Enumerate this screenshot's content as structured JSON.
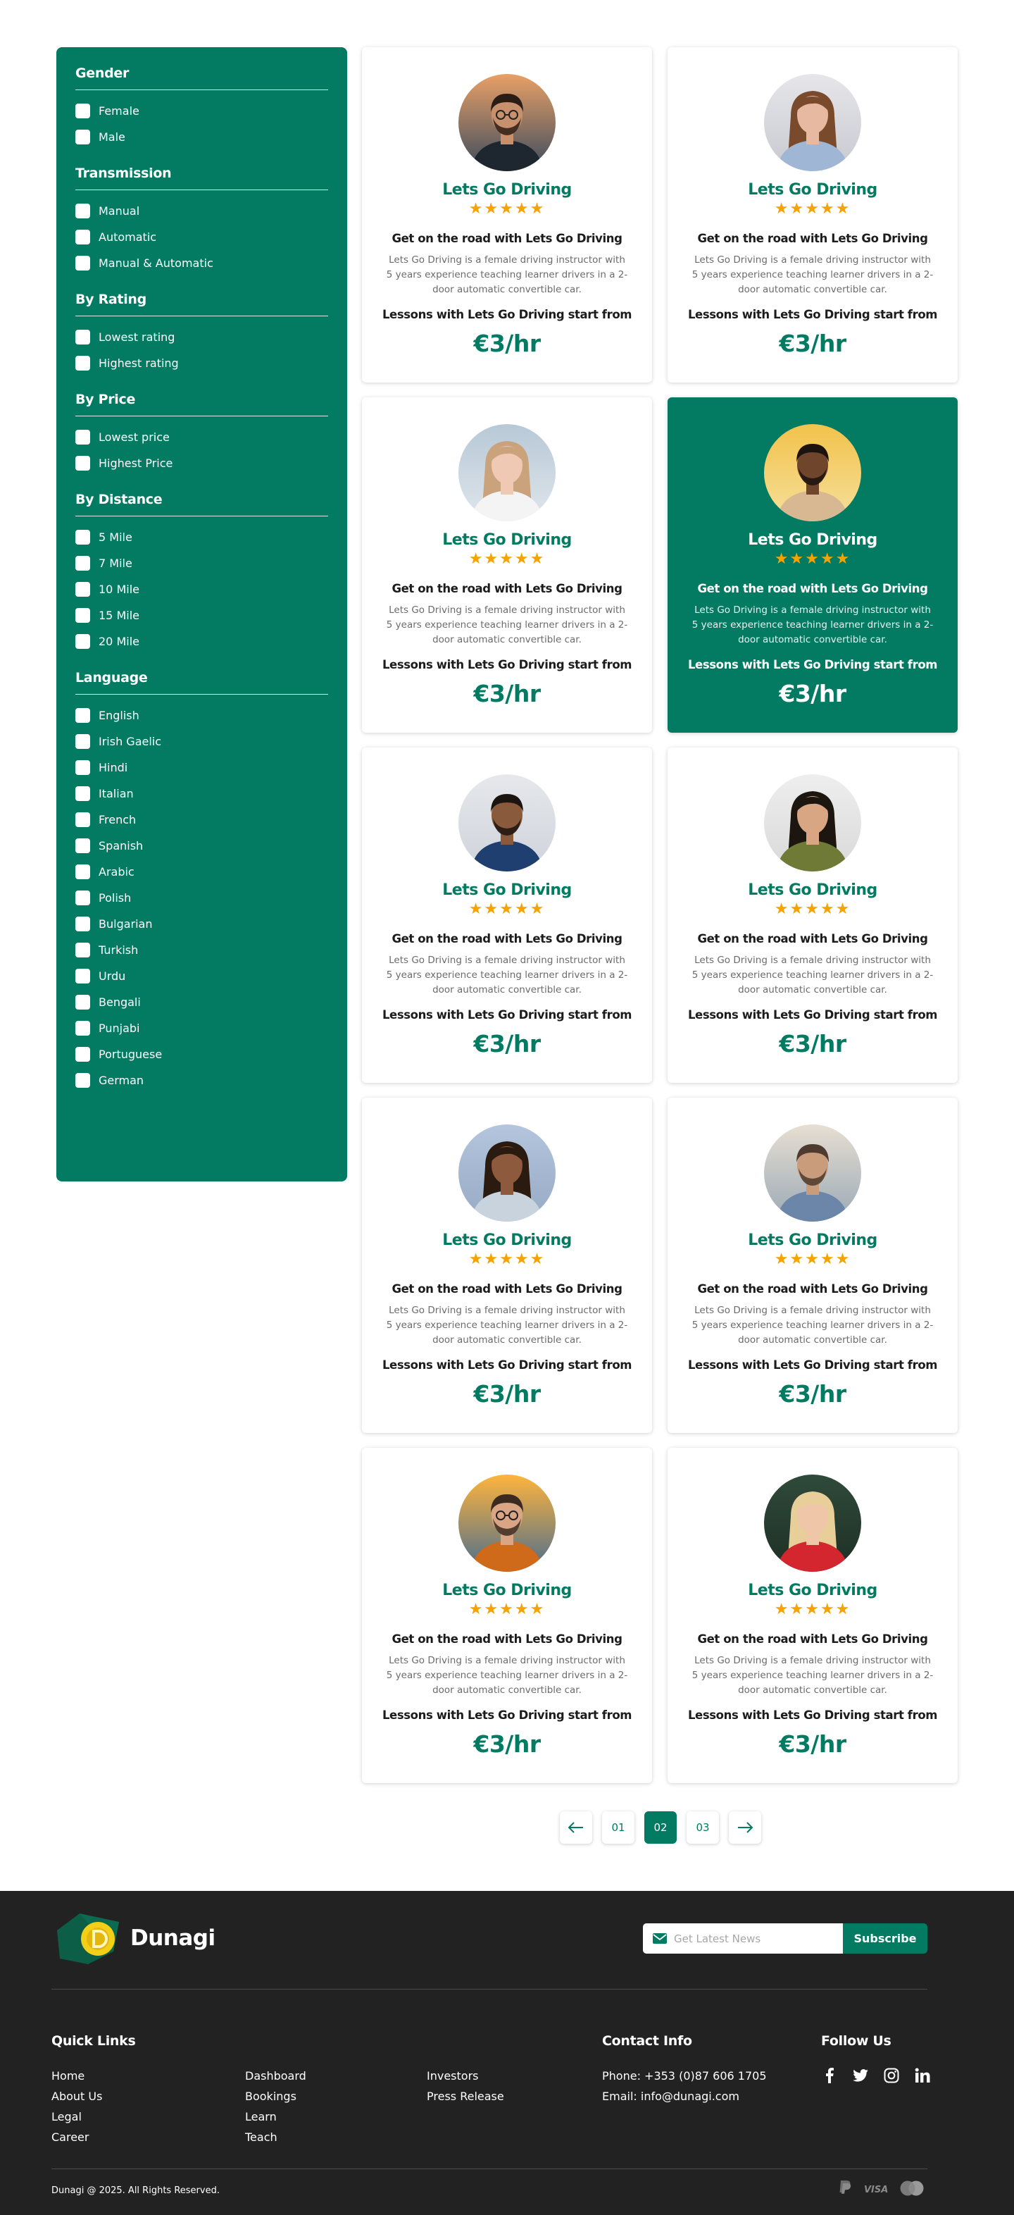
{
  "filters": [
    {
      "title": "Gender",
      "options": [
        "Female",
        "Male"
      ]
    },
    {
      "title": "Transmission",
      "options": [
        "Manual",
        "Automatic",
        "Manual & Automatic"
      ]
    },
    {
      "title": "By Rating",
      "options": [
        "Lowest rating",
        "Highest rating"
      ]
    },
    {
      "title": "By Price",
      "options": [
        "Lowest price",
        "Highest Price"
      ]
    },
    {
      "title": "By Distance",
      "options": [
        "5 Mile",
        "7 Mile",
        "10 Mile",
        "15 Mile",
        "20 Mile"
      ]
    },
    {
      "title": "Language",
      "options": [
        "English",
        "Irish Gaelic",
        "Hindi",
        "Italian",
        "French",
        "Spanish",
        "Arabic",
        "Polish",
        "Bulgarian",
        "Turkish",
        "Urdu",
        "Bengali",
        "Punjabi",
        "Portuguese",
        "German"
      ]
    }
  ],
  "card_text": {
    "name": "Lets Go Driving",
    "stars": "★★★★★",
    "tagline": "Get on the road with Lets Go Driving",
    "description": "Lets Go Driving is a female driving instructor with 5 years experience teaching learner drivers in a 2-door automatic convertible car.",
    "lesson": "Lessons with Lets Go Driving start from",
    "price": "€3/hr"
  },
  "cards": [
    {
      "photo": "man-sunset-glasses",
      "active": false
    },
    {
      "photo": "woman-long-hair",
      "active": false
    },
    {
      "photo": "woman-thinking",
      "active": false
    },
    {
      "photo": "man-phone-smiling",
      "active": true
    },
    {
      "photo": "man-blue-sweater",
      "active": false
    },
    {
      "photo": "woman-green-shirt",
      "active": false
    },
    {
      "photo": "woman-curly-hair",
      "active": false
    },
    {
      "photo": "man-denim-jacket",
      "active": false
    },
    {
      "photo": "man-orange-jacket",
      "active": false
    },
    {
      "photo": "woman-red-top",
      "active": false
    }
  ],
  "pagination": {
    "prev": "←",
    "pages": [
      "01",
      "02",
      "03"
    ],
    "current": "02",
    "next": "→"
  },
  "footer": {
    "brand": "Dunagi",
    "newsletter_placeholder": "Get Latest News",
    "subscribe": "Subscribe",
    "quick_links_title": "Quick Links",
    "links_col1": [
      "Home",
      "About Us",
      "Legal",
      "Career"
    ],
    "links_col2": [
      "Dashboard",
      "Bookings",
      "Learn",
      "Teach"
    ],
    "links_col3": [
      "Investors",
      "Press Release"
    ],
    "contact_title": "Contact Info",
    "phone": "Phone: +353 (0)87 606 1705",
    "email": "Email: info@dunagi.com",
    "follow_title": "Follow Us",
    "social": [
      "facebook-icon",
      "twitter-icon",
      "instagram-icon",
      "linkedin-icon"
    ],
    "copyright": "Dunagi @ 2025. All Rights Reserved.",
    "payments": [
      "paypal-icon",
      "visa-icon",
      "mastercard-icon"
    ],
    "payment_labels": {
      "visa": "VISA"
    }
  },
  "colors": {
    "brand": "#037a62",
    "star": "#f5a300",
    "footer_bg": "#222222"
  }
}
